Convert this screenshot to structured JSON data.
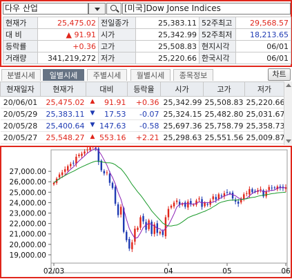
{
  "header": {
    "symbol": "다우 산업",
    "index_name": "[미국]Dow Jonse Indices"
  },
  "quote": {
    "rows": [
      {
        "l1": "현재가",
        "v1": "25,475.02",
        "c1": "red",
        "l2": "전일종가",
        "v2": "25,383.11",
        "c2": "",
        "l3": "52주최고",
        "v3": "29,568.57",
        "c3": "red"
      },
      {
        "l1": "대  비",
        "v1": "▲  91.91",
        "c1": "red",
        "l2": "시가",
        "v2": "25,342.99",
        "c2": "",
        "l3": "52주최저",
        "v3": "18,213.65",
        "c3": "blue"
      },
      {
        "l1": "등락률",
        "v1": "+0.36",
        "c1": "red",
        "l2": "고가",
        "v2": "25,508.83",
        "c2": "",
        "l3": "현지시각",
        "v3": "06/01",
        "c3": ""
      },
      {
        "l1": "거래량",
        "v1": "341,219,272",
        "c1": "",
        "l2": "저가",
        "v2": "25,220.66",
        "c2": "",
        "l3": "한국시각",
        "v3": "06/01",
        "c3": ""
      }
    ]
  },
  "tabs": [
    "분별시세",
    "일별시세",
    "주별시세",
    "월별시세",
    "종목정보"
  ],
  "active_tab": 1,
  "correlation_button": "차트",
  "daily": {
    "headers": [
      "현재일자",
      "현재가",
      "대비",
      "등락율",
      "시가",
      "고가",
      "저가"
    ],
    "rows": [
      {
        "date": "20/06/01",
        "close": "25,475.02",
        "dir": "▲",
        "chg": "91.91",
        "rate": "+0.36",
        "open": "25,342.99",
        "high": "25,508.83",
        "low": "25,220.66",
        "color": "red"
      },
      {
        "date": "20/05/29",
        "close": "25,383.11",
        "dir": "▼",
        "chg": "17.53",
        "rate": "-0.07",
        "open": "25,324.15",
        "high": "25,482.80",
        "low": "25,031.67",
        "color": "blue"
      },
      {
        "date": "20/05/28",
        "close": "25,400.64",
        "dir": "▼",
        "chg": "147.63",
        "rate": "-0.58",
        "open": "25,697.36",
        "high": "25,758.79",
        "low": "25,358.73",
        "color": "blue"
      },
      {
        "date": "20/05/27",
        "close": "25,548.27",
        "dir": "▲",
        "chg": "553.16",
        "rate": "+2.21",
        "open": "25,298.63",
        "high": "25,551.56",
        "low": "25,009.87",
        "color": "red"
      }
    ]
  },
  "chart_data": {
    "type": "candlestick",
    "y_ticks": [
      "27,000.00",
      "26,000.00",
      "25,000.00",
      "24,000.00",
      "23,000.00",
      "22,000.00",
      "21,000.00",
      "20,000.00",
      "19,000.00"
    ],
    "ylim": [
      18600,
      28000
    ],
    "x_labels": [
      {
        "label": "02/03",
        "i": 0
      },
      {
        "label": "04",
        "i": 41
      },
      {
        "label": "05",
        "i": 62
      },
      {
        "label": "06",
        "i": 83
      }
    ],
    "closes": [
      25900,
      26300,
      26700,
      26900,
      27200,
      27500,
      27700,
      27800,
      28400,
      28600,
      28700,
      28900,
      29100,
      29300,
      29400,
      29200,
      27900,
      27100,
      26800,
      26900,
      25900,
      25400,
      23900,
      22800,
      23600,
      21200,
      20400,
      19600,
      20200,
      21500,
      21600,
      22600,
      22200,
      21400,
      22300,
      21000,
      21900,
      21100,
      21200,
      20900,
      22600,
      23400,
      23700,
      24000,
      24200,
      23800,
      23900,
      23600,
      24100,
      23900,
      23800,
      24200,
      24400,
      23600,
      24000,
      23800,
      24200,
      24600,
      24300,
      24800,
      24600,
      24900,
      25000,
      24900,
      24400,
      24100,
      23900,
      24400,
      24800,
      24900,
      25300,
      25000,
      25100,
      25200,
      25300,
      24600,
      25100,
      25500,
      25400,
      25400,
      25548,
      25400,
      25383,
      25475
    ],
    "color_up": "#e0261b",
    "color_down": "#1f3bb3",
    "ma_short_color": "#8a1fb5",
    "ma_long_color": "#1a9a2a"
  }
}
